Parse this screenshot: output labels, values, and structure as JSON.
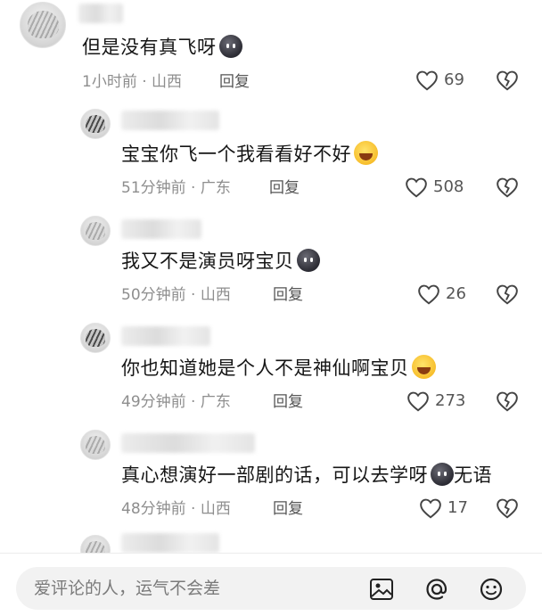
{
  "comments": [
    {
      "text": "但是没有真飞呀",
      "emoji": "dark-face-emoji",
      "time_location": "1小时前 · 山西",
      "reply_label": "回复",
      "likes": "69"
    },
    {
      "text": "宝宝你飞一个我看看好不好",
      "emoji": "crying-face-emoji",
      "time_location": "51分钟前 · 广东",
      "reply_label": "回复",
      "likes": "508"
    },
    {
      "text": "我又不是演员呀宝贝",
      "emoji": "dark-face-emoji",
      "time_location": "50分钟前 · 山西",
      "reply_label": "回复",
      "likes": "26"
    },
    {
      "text": "你也知道她是个人不是神仙啊宝贝",
      "emoji": "laughing-tears-emoji",
      "time_location": "49分钟前 · 广东",
      "reply_label": "回复",
      "likes": "273"
    },
    {
      "text": "真心想演好一部剧的话，可以去学呀",
      "text_after_emoji": "无语",
      "emoji": "dark-face-emoji",
      "time_location": "48分钟前 · 山西",
      "reply_label": "回复",
      "likes": "17"
    }
  ],
  "input": {
    "placeholder": "爱评论的人，运气不会差"
  },
  "icons": [
    "image-icon",
    "at-icon",
    "emoji-icon",
    "heart-icon",
    "dislike-heart-icon"
  ]
}
